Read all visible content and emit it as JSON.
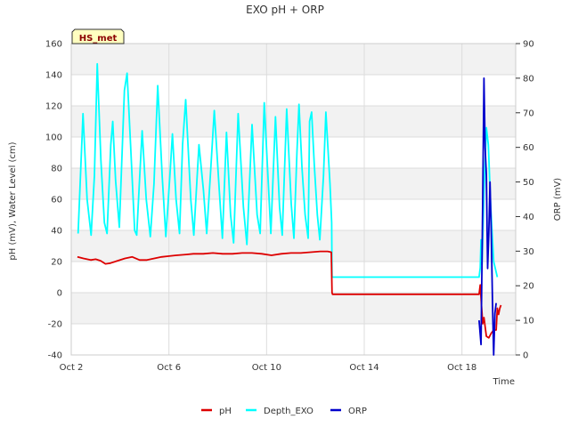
{
  "chart_data": {
    "type": "line",
    "title": "EXO pH + ORP",
    "xlabel": "Time",
    "ylabel_left": "pH (mV), Water Level (cm)",
    "ylabel_right": "ORP (mV)",
    "badge": "HS_met",
    "xlim": [
      0,
      18.2
    ],
    "x_tick_labels": [
      "Oct 2",
      "Oct 6",
      "Oct 10",
      "Oct 14",
      "Oct 18"
    ],
    "x_tick_values": [
      0,
      4,
      8,
      12,
      16
    ],
    "ylim_left": [
      -40,
      160
    ],
    "y_ticks_left": [
      -40,
      -20,
      0,
      20,
      40,
      60,
      80,
      100,
      120,
      140,
      160
    ],
    "ylim_right": [
      0,
      90
    ],
    "y_ticks_right": [
      0,
      10,
      20,
      30,
      40,
      50,
      60,
      70,
      80,
      90
    ],
    "grid": true,
    "legend_position": "bottom-center",
    "series": [
      {
        "name": "pH",
        "axis": "left",
        "color": "#dd0000",
        "x": [
          0.25,
          0.5,
          0.8,
          1.0,
          1.2,
          1.4,
          1.6,
          1.9,
          2.2,
          2.5,
          2.8,
          3.1,
          3.4,
          3.7,
          4.0,
          4.3,
          4.7,
          5.0,
          5.4,
          5.8,
          6.2,
          6.6,
          7.0,
          7.4,
          7.8,
          8.2,
          8.6,
          9.0,
          9.4,
          9.8,
          10.2,
          10.5,
          10.65,
          10.68,
          10.7,
          12.0,
          14.0,
          16.0,
          16.7,
          16.75,
          16.8,
          16.85,
          16.9,
          17.0,
          17.1,
          17.2,
          17.3,
          17.4,
          17.45,
          17.5,
          17.55,
          17.6
        ],
        "y": [
          23,
          22,
          21,
          21.5,
          20.5,
          18.5,
          19,
          20.5,
          22,
          23,
          21,
          21,
          22,
          23,
          23.5,
          24,
          24.5,
          25,
          25,
          25.5,
          25,
          25,
          25.5,
          25.5,
          25,
          24,
          25,
          25.5,
          25.5,
          26,
          26.5,
          26.5,
          26,
          0,
          -1,
          -1,
          -1,
          -1,
          -1,
          5,
          -8,
          -20,
          -16,
          -28,
          -29,
          -26,
          -24,
          -24,
          -10,
          -14,
          -10,
          -8
        ]
      },
      {
        "name": "Depth_EXO",
        "axis": "left",
        "color": "#00ffff",
        "x": [],
        "y": []
      },
      {
        "name": "ORP",
        "axis": "right",
        "color": "#0000cc",
        "x": [
          16.7,
          16.78,
          16.85,
          16.9,
          16.95,
          17.0,
          17.05,
          17.1,
          17.15,
          17.2,
          17.25,
          17.3,
          17.35,
          17.4
        ],
        "y": [
          10,
          3,
          45,
          80,
          60,
          52,
          25,
          35,
          50,
          35,
          15,
          0,
          12,
          15
        ]
      }
    ]
  }
}
